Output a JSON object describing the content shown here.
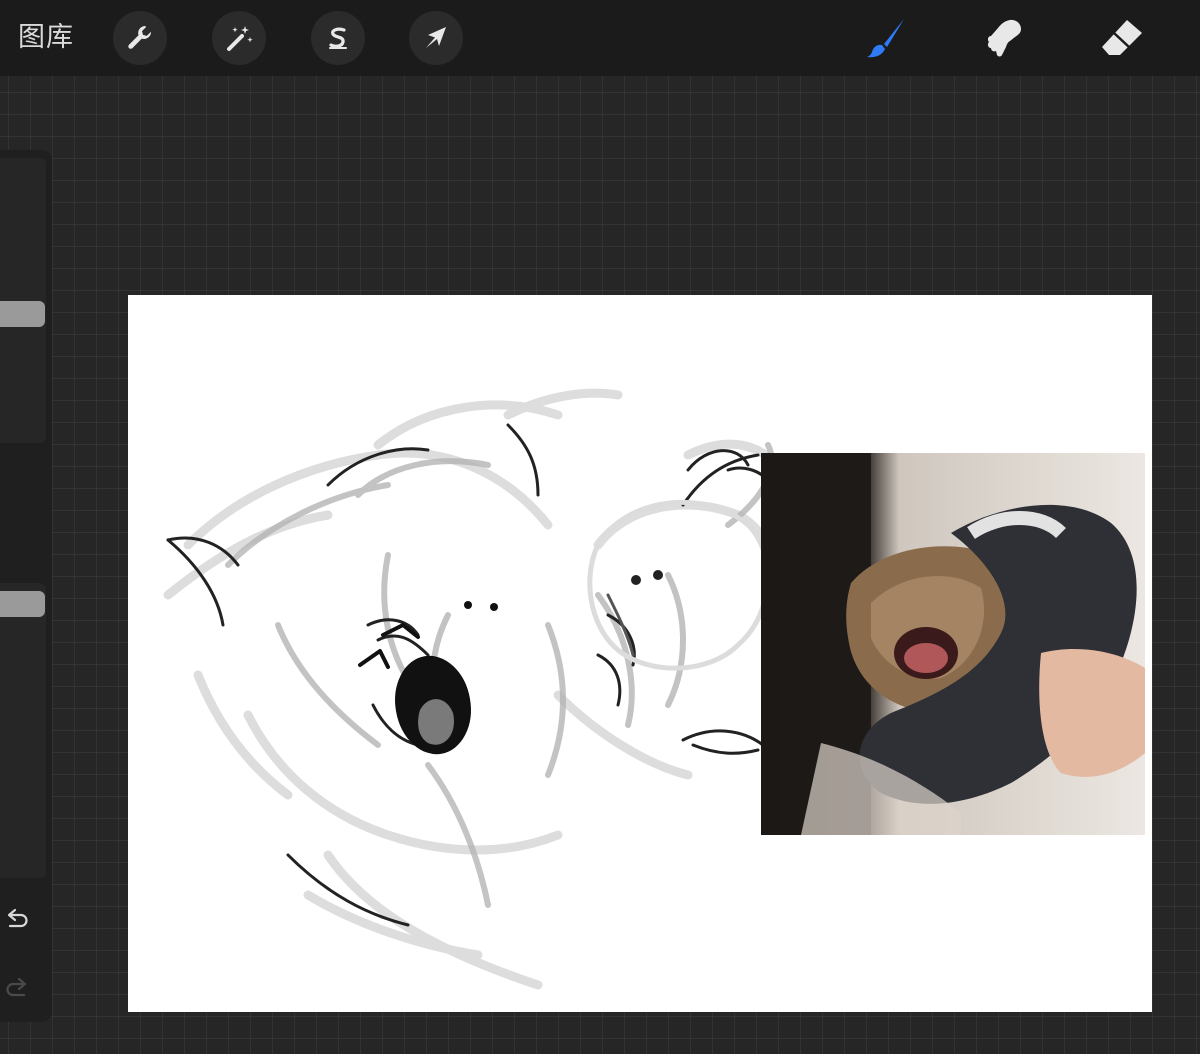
{
  "topbar": {
    "gallery_label": "图库",
    "left_tools": [
      "wrench-icon",
      "magic-wand-icon",
      "selection-s-icon",
      "transform-arrow-icon"
    ],
    "right_tools": [
      "brush-icon",
      "smudge-icon",
      "eraser-icon"
    ],
    "active_tool": "brush",
    "accent_color": "#2f7bf5"
  },
  "sidebar": {
    "controls": [
      "brush-size-slider",
      "modify-square-button",
      "opacity-slider",
      "undo-arrow-icon",
      "redo-arrow-icon"
    ],
    "redo_enabled": false
  },
  "canvas": {
    "background_color": "#ffffff",
    "contents": [
      "sketch-drawing",
      "reference-photo"
    ]
  }
}
